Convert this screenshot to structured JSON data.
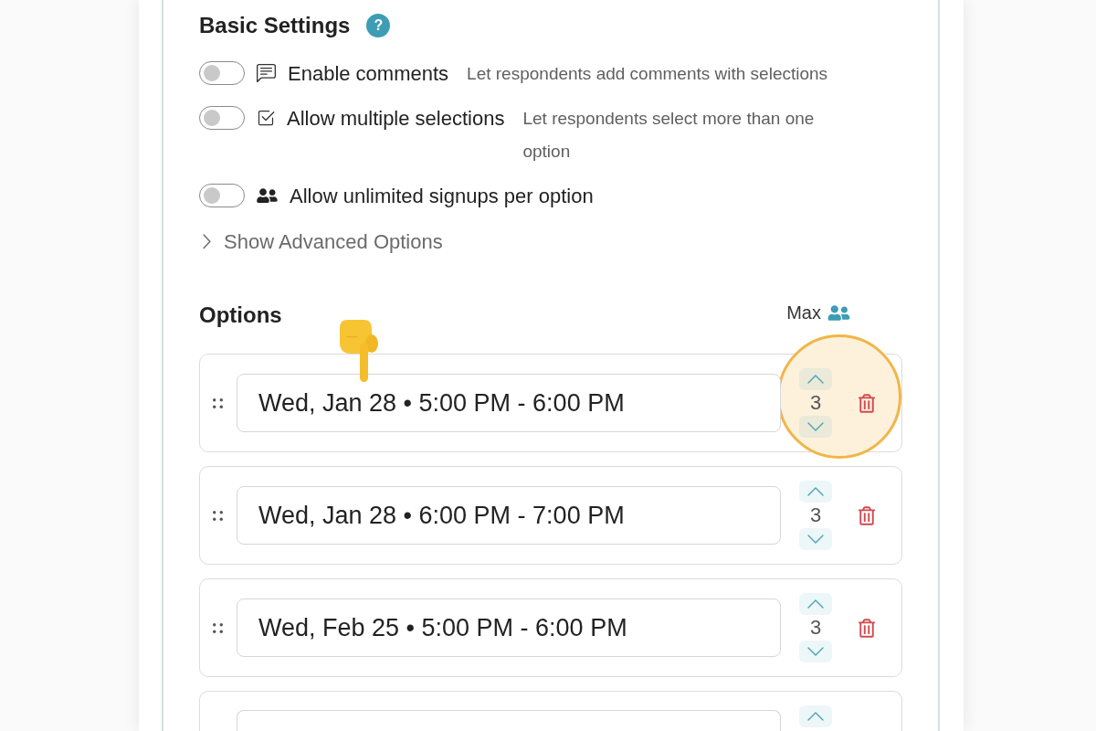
{
  "basic_settings": {
    "title": "Basic Settings",
    "help_label": "?"
  },
  "settings": [
    {
      "kind": "comments",
      "label": "Enable comments",
      "description": "Let respondents add comments with selections",
      "on": false
    },
    {
      "kind": "selections",
      "label": "Allow multiple selections",
      "description": "Let respondents select more than one option",
      "on": false
    },
    {
      "kind": "signups",
      "label": "Allow unlimited signups per option",
      "on": false
    }
  ],
  "advanced_options": {
    "label": "Show Advanced Options",
    "expanded": false
  },
  "options_section": {
    "title": "Options",
    "max_label": "Max"
  },
  "options": [
    {
      "label": "Wed, Jan 28 • 5:00 PM - 6:00 PM",
      "max": "3",
      "highlighted": true,
      "pointed_at": true
    },
    {
      "label": "Wed, Jan 28 • 6:00 PM - 7:00 PM",
      "max": "3",
      "highlighted": false,
      "pointed_at": false
    },
    {
      "label": "Wed, Feb 25 • 5:00 PM - 6:00 PM",
      "max": "3",
      "highlighted": false,
      "pointed_at": false
    }
  ],
  "more_options_below": true
}
